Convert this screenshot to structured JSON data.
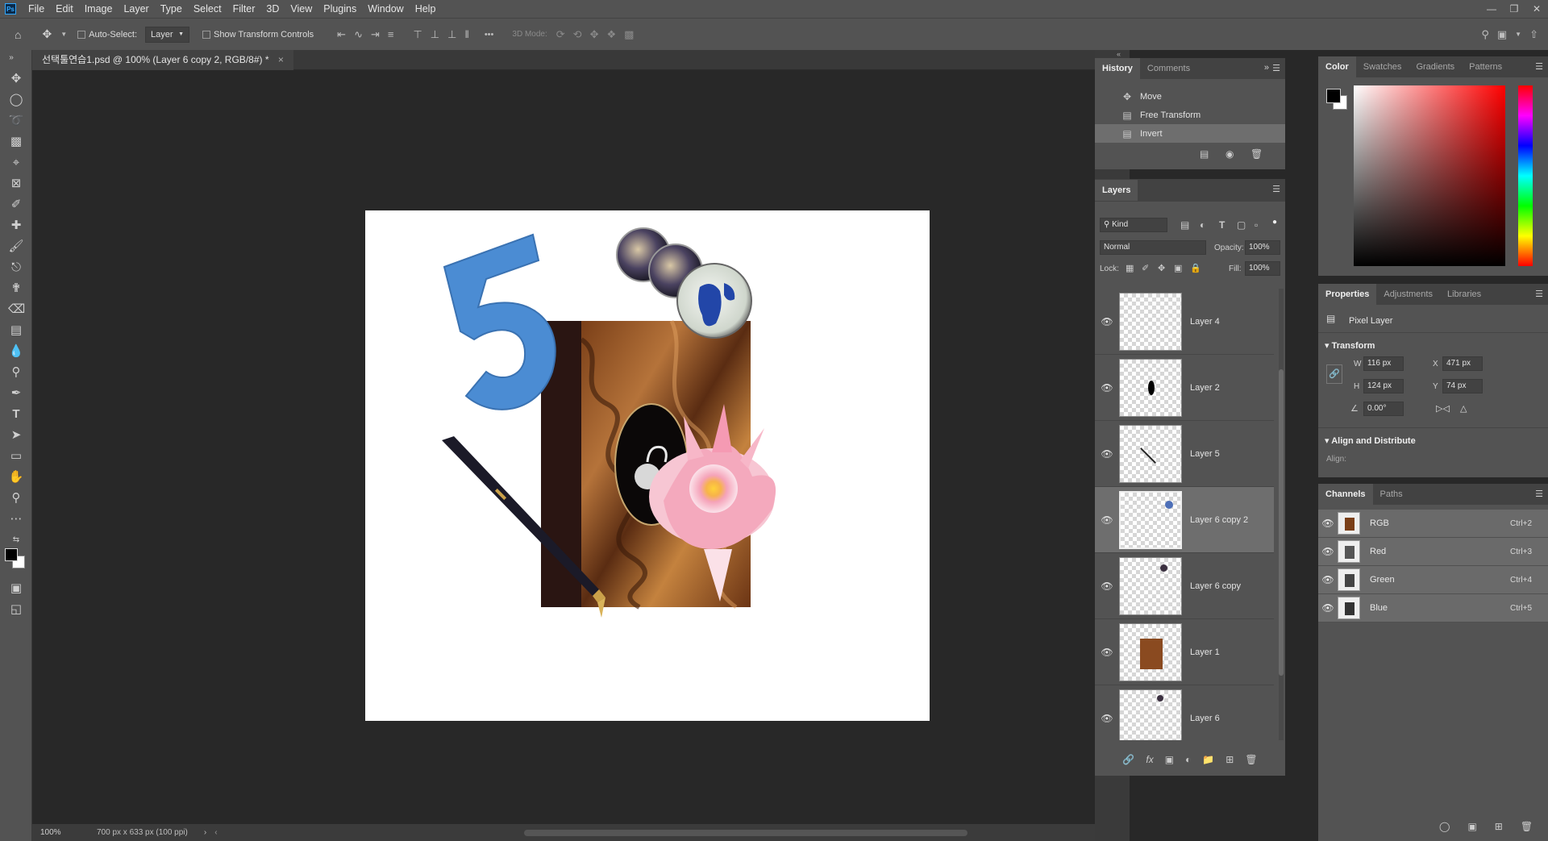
{
  "app": {
    "logo": "Ps"
  },
  "menu": [
    "File",
    "Edit",
    "Image",
    "Layer",
    "Type",
    "Select",
    "Filter",
    "3D",
    "View",
    "Plugins",
    "Window",
    "Help"
  ],
  "options": {
    "auto_select_label": "Auto-Select:",
    "auto_select_value": "Layer",
    "show_transform_label": "Show Transform Controls",
    "mode_3d_label": "3D Mode:",
    "more_label": "•••"
  },
  "document": {
    "tab_title": "선택툴연습1.psd @ 100% (Layer 6 copy 2, RGB/8#) *",
    "tab_close": "×",
    "zoom": "100%",
    "doc_info": "700 px x 633 px (100 ppi)"
  },
  "history": {
    "tabs": [
      "History",
      "Comments"
    ],
    "items": [
      {
        "label": "Move",
        "icon": "move-icon"
      },
      {
        "label": "Free Transform",
        "icon": "document-icon"
      },
      {
        "label": "Invert",
        "icon": "document-icon"
      }
    ]
  },
  "layers": {
    "tab": "Layers",
    "filter_kind": "Kind",
    "blend_mode": "Normal",
    "opacity_label": "Opacity:",
    "opacity_value": "100%",
    "lock_label": "Lock:",
    "fill_label": "Fill:",
    "fill_value": "100%",
    "items": [
      {
        "name": "Layer 4",
        "selected": false
      },
      {
        "name": "Layer 2",
        "selected": false
      },
      {
        "name": "Layer 5",
        "selected": false
      },
      {
        "name": "Layer 6 copy 2",
        "selected": true
      },
      {
        "name": "Layer 6 copy",
        "selected": false
      },
      {
        "name": "Layer 1",
        "selected": false
      },
      {
        "name": "Layer 6",
        "selected": false
      }
    ]
  },
  "color": {
    "tabs": [
      "Color",
      "Swatches",
      "Gradients",
      "Patterns"
    ],
    "foreground": "#000000",
    "background": "#ffffff",
    "hue": "#ff0000"
  },
  "properties": {
    "tabs": [
      "Properties",
      "Adjustments",
      "Libraries"
    ],
    "kind": "Pixel Layer",
    "transform_title": "Transform",
    "w_label": "W",
    "w_value": "116 px",
    "h_label": "H",
    "h_value": "124 px",
    "x_label": "X",
    "x_value": "471 px",
    "y_label": "Y",
    "y_value": "74 px",
    "angle_value": "0.00°",
    "align_title": "Align and Distribute",
    "align_label": "Align:"
  },
  "channels": {
    "tabs": [
      "Channels",
      "Paths"
    ],
    "items": [
      {
        "name": "RGB",
        "shortcut": "Ctrl+2"
      },
      {
        "name": "Red",
        "shortcut": "Ctrl+3"
      },
      {
        "name": "Green",
        "shortcut": "Ctrl+4"
      },
      {
        "name": "Blue",
        "shortcut": "Ctrl+5"
      }
    ]
  }
}
